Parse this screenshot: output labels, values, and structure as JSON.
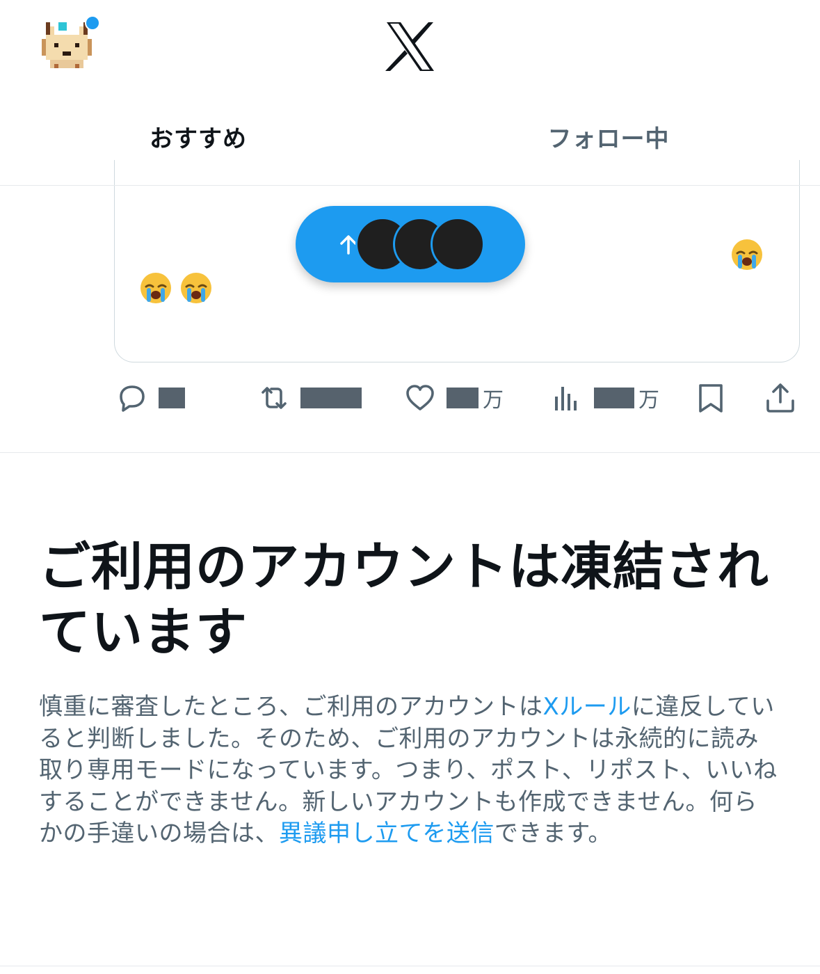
{
  "header": {
    "logo": "X",
    "avatar_icon": "pixel-fox-avatar-icon",
    "notification_dot_color": "#1d9bf0"
  },
  "tabs": [
    {
      "label": "おすすめ",
      "active": true
    },
    {
      "label": "フォロー中",
      "active": false
    }
  ],
  "post": {
    "new_posts_pill": {
      "icon": "arrow-up-icon",
      "avatar_count": 3,
      "color": "#1d9bf0"
    },
    "emoji": [
      "😭",
      "😭",
      "😭"
    ],
    "actions": {
      "reply": {
        "icon": "reply-icon",
        "count": "",
        "suffix": ""
      },
      "repost": {
        "icon": "repost-icon",
        "count": "",
        "suffix": ""
      },
      "like": {
        "icon": "heart-icon",
        "count": "",
        "suffix": "万"
      },
      "views": {
        "icon": "views-chart-icon",
        "count": "",
        "suffix": "万"
      },
      "bookmark": {
        "icon": "bookmark-icon"
      },
      "share": {
        "icon": "share-icon"
      }
    }
  },
  "notice": {
    "title": "ご利用のアカウントは凍結されています",
    "body_part1": "慎重に審査したところ、ご利用のアカウントは",
    "link_rules": "Xルール",
    "body_part2": "に違反していると判断しました。そのため、ご利用のアカウントは永続的に読み取り専用モードになっています。つまり、ポスト、リポスト、いいねすることができません。新しいアカウントも作成できません。何らかの手違いの場合は、",
    "link_appeal": "異議申し立てを送信",
    "body_part3": "できます。"
  },
  "colors": {
    "accent": "#1d9bf0",
    "text_primary": "#0f1419",
    "text_secondary": "#536471"
  }
}
